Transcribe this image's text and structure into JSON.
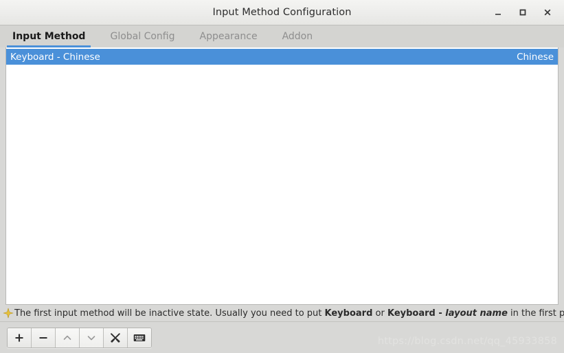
{
  "window": {
    "title": "Input Method Configuration",
    "controls": [
      {
        "name": "minimize-button",
        "icon": "minimize-icon",
        "label": "_"
      },
      {
        "name": "maximize-button",
        "icon": "maximize-icon",
        "label": "□"
      },
      {
        "name": "close-button",
        "icon": "close-icon",
        "label": "✕"
      }
    ]
  },
  "tabs": [
    {
      "label": "Input Method",
      "active": true
    },
    {
      "label": "Global Config",
      "active": false
    },
    {
      "label": "Appearance",
      "active": false
    },
    {
      "label": "Addon",
      "active": false
    }
  ],
  "list": {
    "rows": [
      {
        "name": "Keyboard - Chinese",
        "language": "Chinese",
        "selected": true
      }
    ]
  },
  "hint": {
    "icon": "star-icon",
    "full_text": "The first input method will be inactive state. Usually you need to put Keyboard or Keyboard - layout name in the first place.",
    "part1": "The first input method will be inactive state. Usually you need to put ",
    "bold1": "Keyboard",
    "part2": " or ",
    "bold2": "Keyboard - ",
    "italic1": "layout name",
    "part3": " in the first place."
  },
  "toolbar": {
    "buttons": [
      {
        "name": "add-button",
        "icon": "plus-icon",
        "enabled": true
      },
      {
        "name": "remove-button",
        "icon": "minus-icon",
        "enabled": true
      },
      {
        "name": "move-up-button",
        "icon": "chevron-up-icon",
        "enabled": false
      },
      {
        "name": "move-down-button",
        "icon": "chevron-down-icon",
        "enabled": false
      },
      {
        "name": "configure-button",
        "icon": "tools-icon",
        "enabled": true
      },
      {
        "name": "keyboard-layout-button",
        "icon": "keyboard-icon",
        "enabled": true
      }
    ]
  },
  "watermark": {
    "text": "https://blog.csdn.net/qq_45933858"
  },
  "colors": {
    "accent": "#4a90d9",
    "window_bg": "#d8d8d6",
    "titlebar_bg": "#efefed",
    "list_bg": "#ffffff",
    "star": "#e8c13a"
  }
}
